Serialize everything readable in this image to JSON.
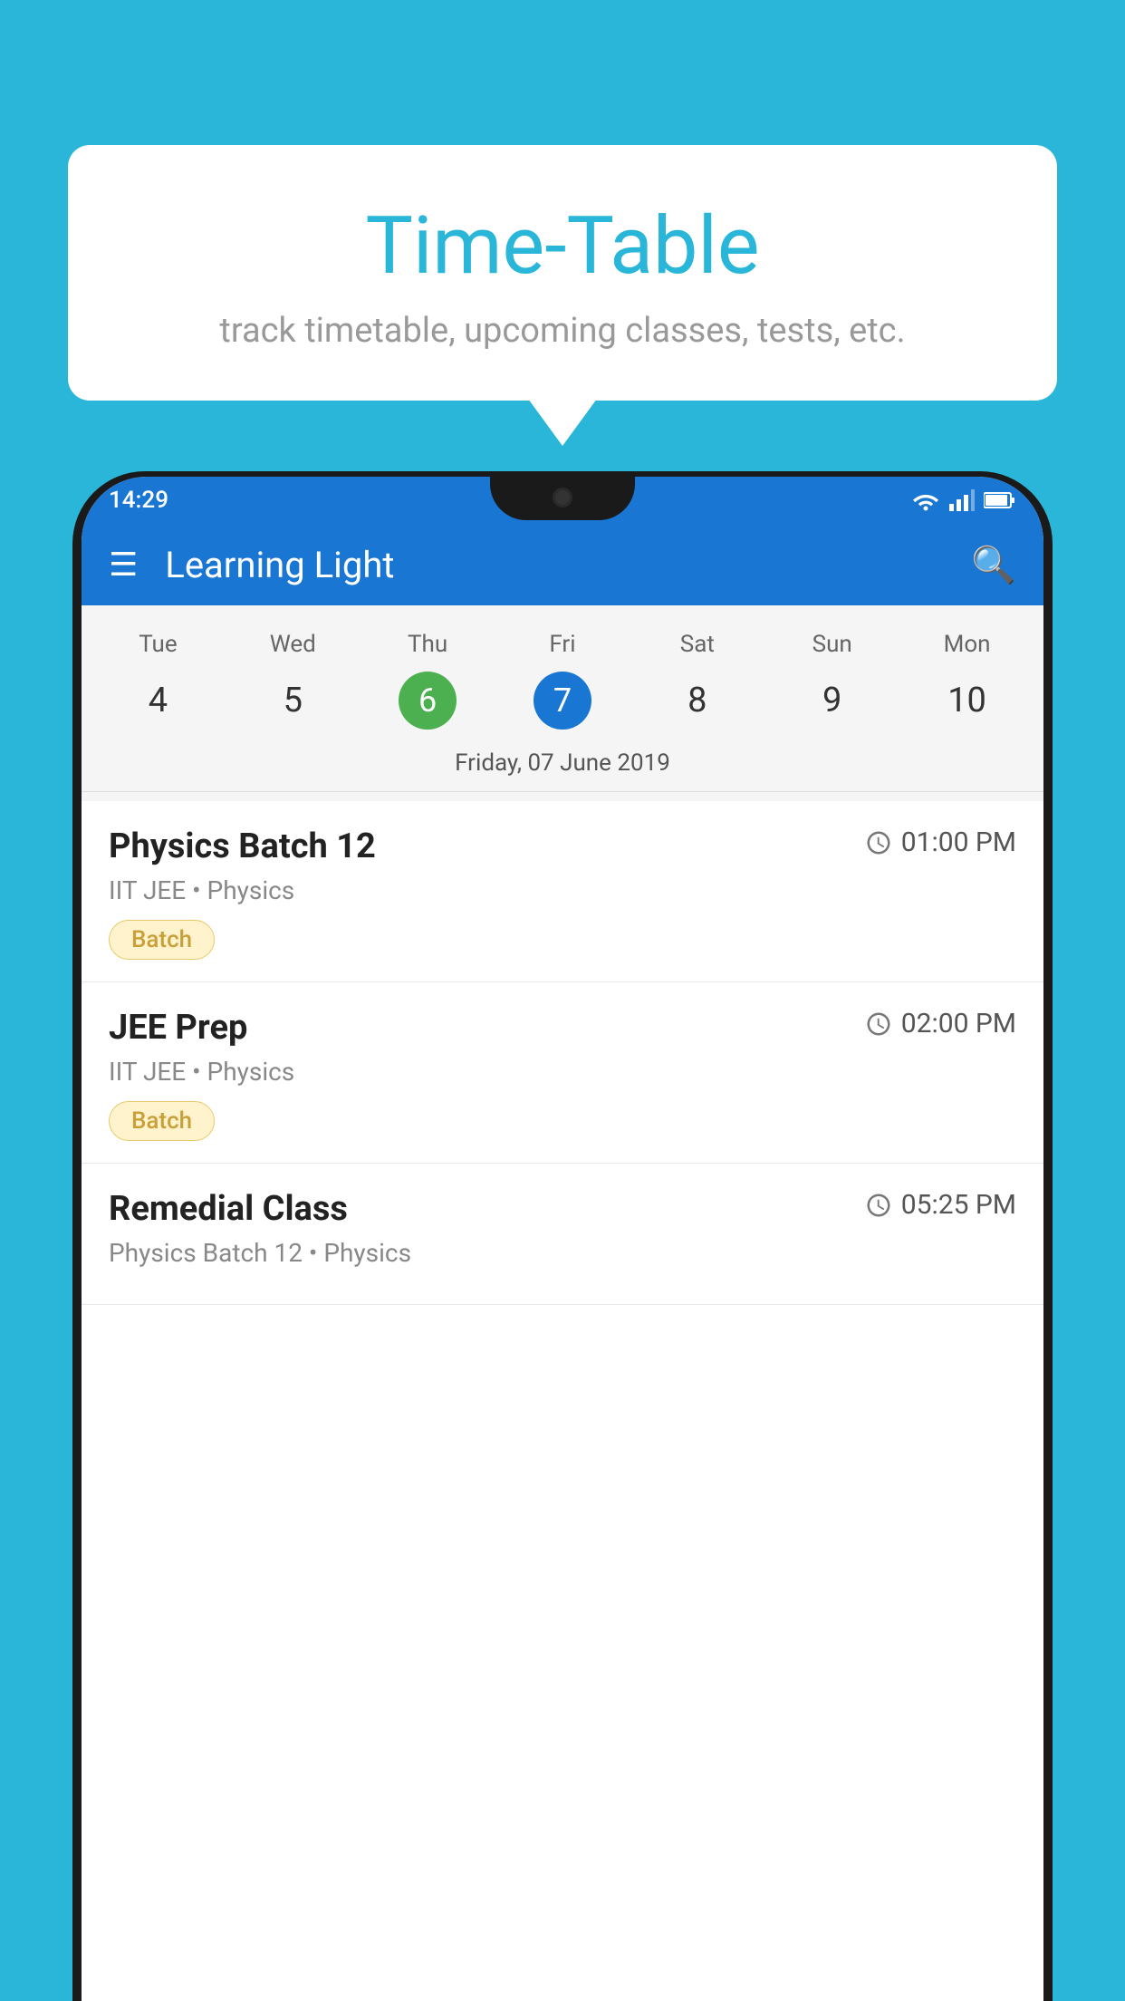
{
  "background": {
    "color": "#29B6D8"
  },
  "speech_bubble": {
    "title": "Time-Table",
    "subtitle": "track timetable, upcoming classes, tests, etc."
  },
  "status_bar": {
    "time": "14:29"
  },
  "app_bar": {
    "title": "Learning Light"
  },
  "calendar": {
    "day_names": [
      "Tue",
      "Wed",
      "Thu",
      "Fri",
      "Sat",
      "Sun",
      "Mon"
    ],
    "day_numbers": [
      "4",
      "5",
      "6",
      "7",
      "8",
      "9",
      "10"
    ],
    "today_index": 2,
    "selected_index": 3,
    "selected_date_label": "Friday, 07 June 2019"
  },
  "schedule_items": [
    {
      "title": "Physics Batch 12",
      "time": "01:00 PM",
      "subtitle": "IIT JEE • Physics",
      "badge": "Batch"
    },
    {
      "title": "JEE Prep",
      "time": "02:00 PM",
      "subtitle": "IIT JEE • Physics",
      "badge": "Batch"
    },
    {
      "title": "Remedial Class",
      "time": "05:25 PM",
      "subtitle": "Physics Batch 12 • Physics",
      "badge": null
    }
  ]
}
